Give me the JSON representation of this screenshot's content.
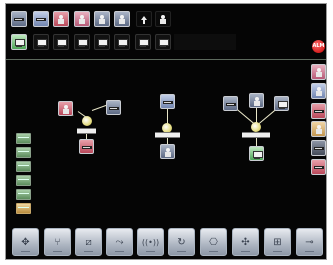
{
  "status": {
    "alarm_text": "ALM"
  },
  "toolbar": {
    "buttons": [
      {
        "icon": "move-arrows-icon",
        "glyph": "✥"
      },
      {
        "icon": "network-tree-icon",
        "glyph": "⑂"
      },
      {
        "icon": "graph-icon",
        "glyph": "⧄"
      },
      {
        "icon": "link-icon",
        "glyph": "⤳"
      },
      {
        "icon": "wireless-icon",
        "glyph": "((•))"
      },
      {
        "icon": "refresh-icon",
        "glyph": "↻"
      },
      {
        "icon": "device-connect-icon",
        "glyph": "⎔"
      },
      {
        "icon": "navigate-icon",
        "glyph": "✣"
      },
      {
        "icon": "grid-icon",
        "glyph": "⊞"
      },
      {
        "icon": "cable-icon",
        "glyph": "⊸"
      }
    ]
  },
  "colors": {
    "background": "#050505",
    "accent_red": "#c40000",
    "link": "#e8e6c8"
  }
}
